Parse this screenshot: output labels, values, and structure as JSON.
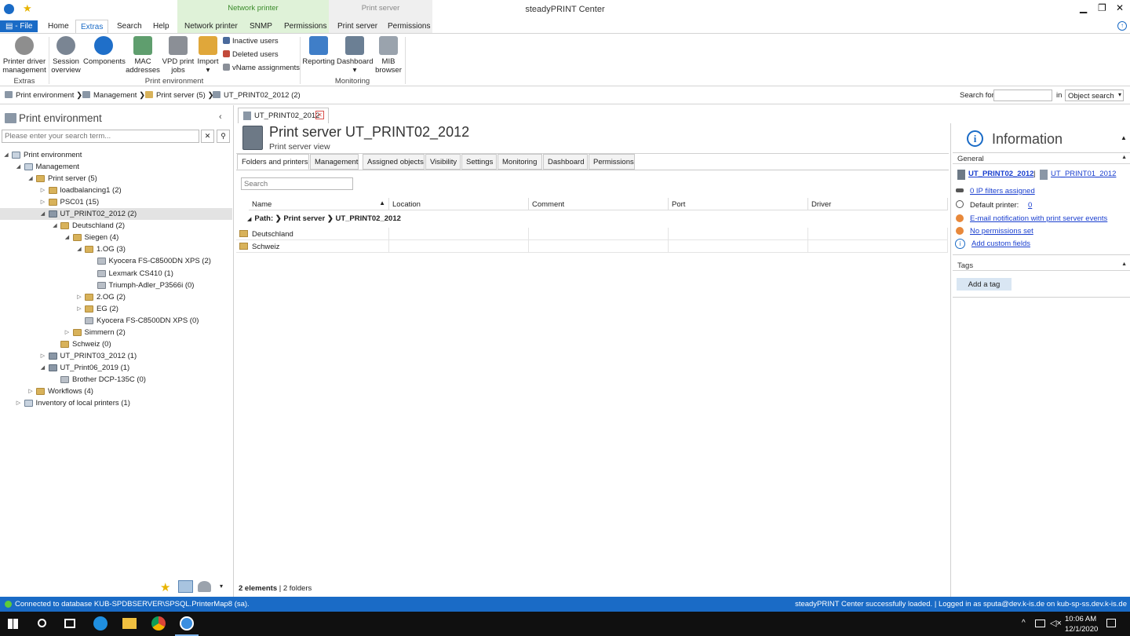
{
  "app": {
    "title": "steadyPRINT Center"
  },
  "menu": {
    "file": "File",
    "tabs": [
      "Home",
      "Extras",
      "Search",
      "Help",
      "Network printer",
      "SNMP",
      "Permissions",
      "Print server",
      "Permissions"
    ],
    "selected_tab": "Extras",
    "context_groups": {
      "network_printer": "Network printer",
      "print_server": "Print server"
    }
  },
  "ribbon": {
    "printer_driver_management": "Printer driver management",
    "session_overview": "Session overview",
    "components": "Components",
    "mac_addresses": "MAC addresses",
    "vpd_print_jobs": "VPD print jobs",
    "import": "Import",
    "inactive_users": "Inactive users",
    "deleted_users": "Deleted users",
    "vname_assignments": "vName assignments",
    "reporting": "Reporting",
    "dashboard": "Dashboard",
    "mib_browser": "MIB browser",
    "group_extras": "Extras",
    "group_print_environment": "Print environment",
    "group_monitoring": "Monitoring"
  },
  "breadcrumb": {
    "items": [
      "Print environment",
      "Management",
      "Print server (5)",
      "UT_PRINT02_2012 (2)"
    ],
    "search_label": "Search for",
    "in_label": "in",
    "scope": "Object search"
  },
  "left_pane": {
    "title": "Print environment",
    "search_placeholder": "Please enter your search term...",
    "tree": [
      {
        "label": "Print environment",
        "level": 0,
        "expanded": true,
        "icon": "env"
      },
      {
        "label": "Management",
        "level": 1,
        "expanded": true,
        "icon": "env"
      },
      {
        "label": "Print server (5)",
        "level": 2,
        "expanded": true,
        "icon": "fold"
      },
      {
        "label": "loadbalancing1 (2)",
        "level": 3,
        "expanded": false,
        "icon": "fold"
      },
      {
        "label": "PSC01 (15)",
        "level": 3,
        "expanded": false,
        "icon": "fold"
      },
      {
        "label": "UT_PRINT02_2012 (2)",
        "level": 3,
        "expanded": true,
        "icon": "srv",
        "selected": true
      },
      {
        "label": "Deutschland (2)",
        "level": 4,
        "expanded": true,
        "icon": "fold"
      },
      {
        "label": "Siegen (4)",
        "level": 5,
        "expanded": true,
        "icon": "fold"
      },
      {
        "label": "1.OG (3)",
        "level": 6,
        "expanded": true,
        "icon": "fold"
      },
      {
        "label": "Kyocera FS-C8500DN XPS (2)",
        "level": 7,
        "icon": "prn"
      },
      {
        "label": "Lexmark CS410 (1)",
        "level": 7,
        "icon": "prn"
      },
      {
        "label": "Triumph-Adler_P3566i (0)",
        "level": 7,
        "icon": "prn"
      },
      {
        "label": "2.OG (2)",
        "level": 6,
        "expanded": false,
        "icon": "fold"
      },
      {
        "label": "EG (2)",
        "level": 6,
        "expanded": false,
        "icon": "fold"
      },
      {
        "label": "Kyocera FS-C8500DN XPS (0)",
        "level": 6,
        "icon": "prn"
      },
      {
        "label": "Simmern (2)",
        "level": 5,
        "expanded": false,
        "icon": "fold"
      },
      {
        "label": "Schweiz (0)",
        "level": 4,
        "icon": "fold"
      },
      {
        "label": "UT_PRINT03_2012 (1)",
        "level": 3,
        "expanded": false,
        "icon": "srv"
      },
      {
        "label": "UT_Print06_2019 (1)",
        "level": 3,
        "expanded": true,
        "icon": "srv"
      },
      {
        "label": "Brother DCP-135C (0)",
        "level": 4,
        "icon": "prn"
      },
      {
        "label": "Workflows (4)",
        "level": 2,
        "expanded": false,
        "icon": "fold"
      },
      {
        "label": "Inventory of local printers (1)",
        "level": 1,
        "expanded": false,
        "icon": "env"
      }
    ]
  },
  "document": {
    "tab_label": "UT_PRINT02_2012",
    "title": "Print server UT_PRINT02_2012",
    "subtitle": "Print server view",
    "subtabs": [
      "Folders and printers",
      "Management",
      "Assigned objects",
      "Visibility",
      "Settings",
      "Monitoring",
      "Dashboard",
      "Permissions"
    ],
    "selected_subtab": "Folders and printers",
    "search_placeholder": "Search",
    "columns": [
      "Name",
      "Location",
      "Comment",
      "Port",
      "Driver"
    ],
    "path_label": "Path:",
    "path": [
      "Print server",
      "UT_PRINT02_2012"
    ],
    "rows": [
      {
        "name": "Deutschland",
        "location": "",
        "comment": "",
        "port": "",
        "driver": ""
      },
      {
        "name": "Schweiz",
        "location": "",
        "comment": "",
        "port": "",
        "driver": ""
      }
    ],
    "footer_count": "2 elements",
    "footer_folders": "| 2 folders"
  },
  "info": {
    "title": "Information",
    "general_label": "General",
    "server_primary": "UT_PRINT02_2012",
    "server_secondary": "UT_PRINT01_2012",
    "ip_filters": "0 IP filters assigned",
    "default_printer_label": "Default printer:",
    "default_printer_value": "0",
    "email_notification": "E-mail notification with print server events",
    "permissions": "No permissions set",
    "custom_fields": "Add custom fields",
    "tags_label": "Tags",
    "add_tag": "Add a tag"
  },
  "status": {
    "left": "Connected to database KUB-SPDBSERVER\\SPSQL.PrinterMap8 (sa).",
    "right": "steadyPRINT Center successfully loaded. | Logged in as sputa@dev.k-is.de on kub-sp-ss.dev.k-is.de"
  },
  "taskbar": {
    "time": "10:06 AM",
    "date": "12/1/2020"
  },
  "colors": {
    "accent": "#1a6bc6",
    "link": "#1a3fcf",
    "network_printer_group": "#dff2d8"
  }
}
